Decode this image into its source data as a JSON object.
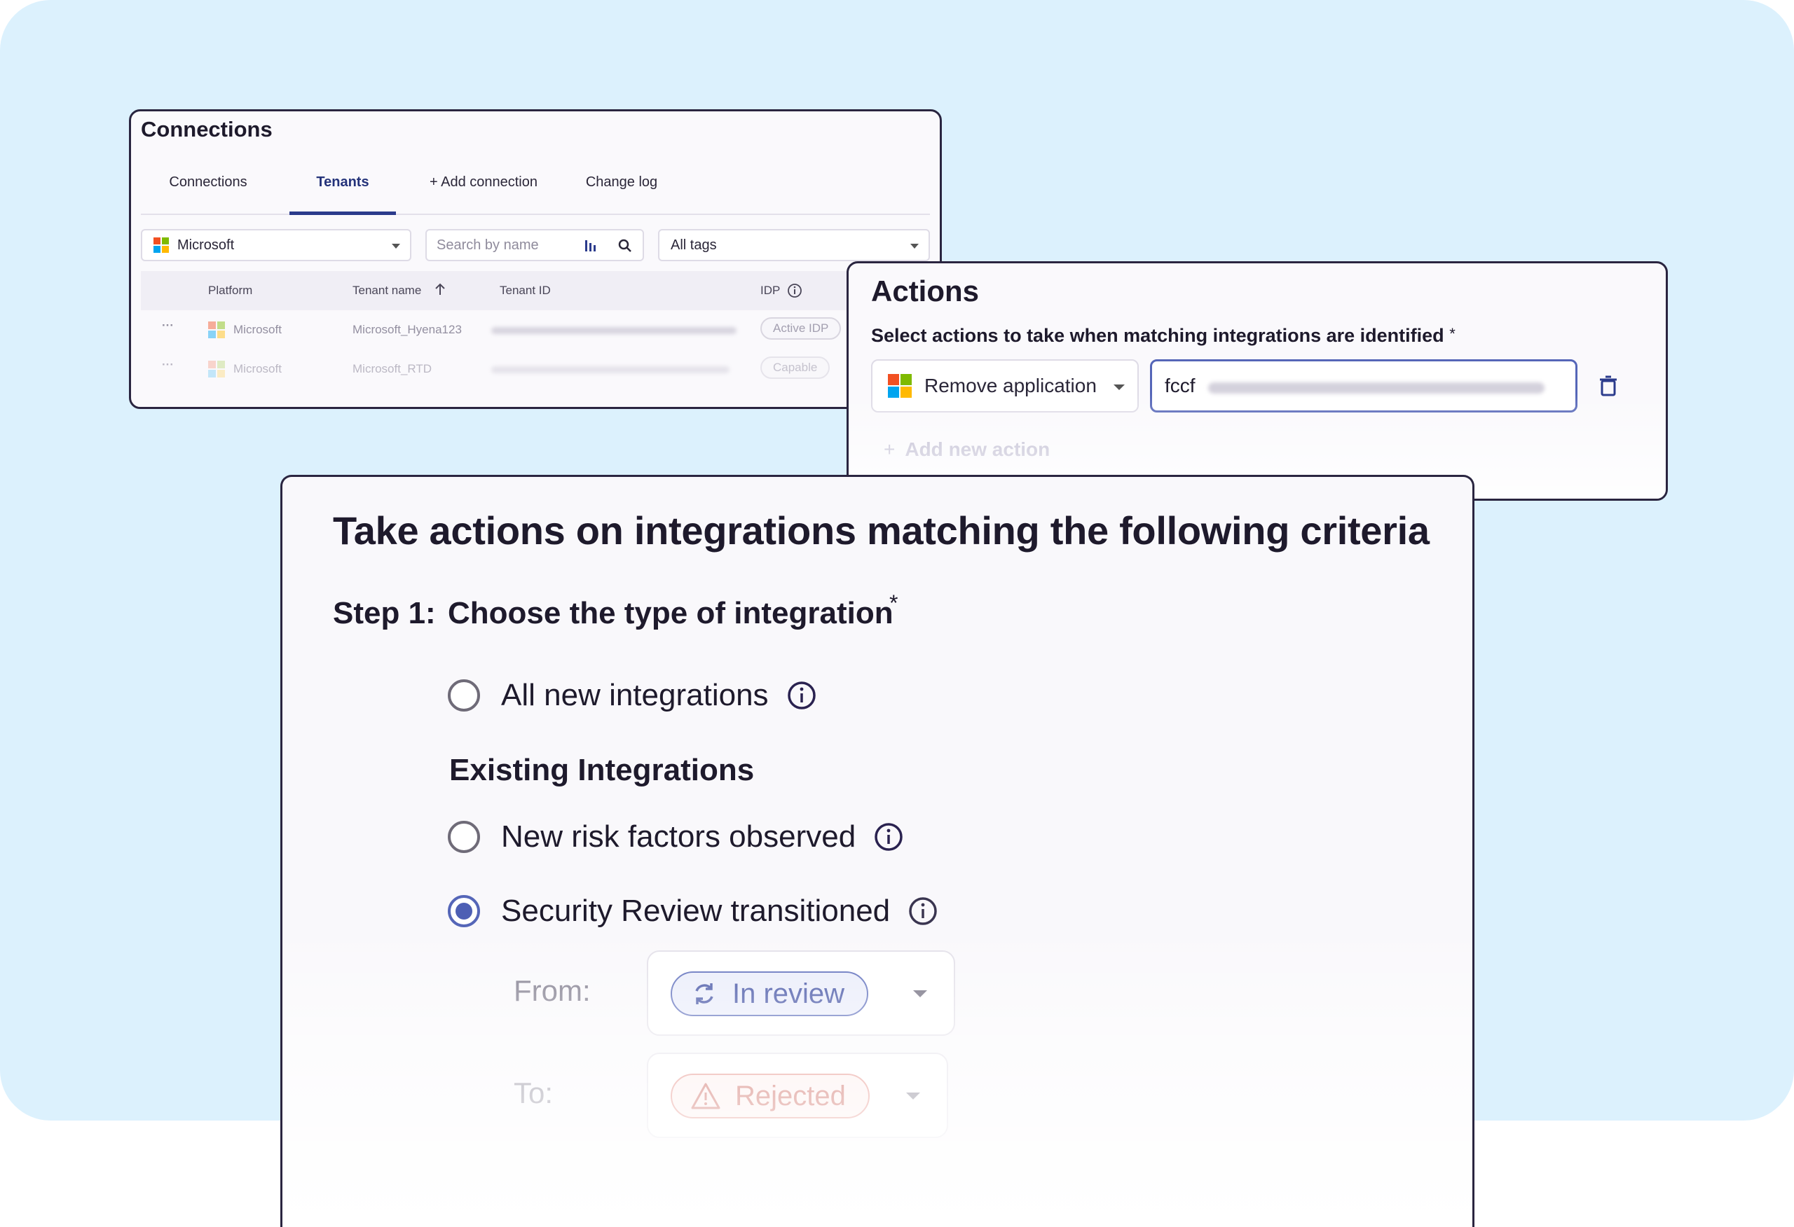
{
  "colors": {
    "background": "#dcf1fd",
    "accent": "#2b3b8c",
    "radio_selected": "#4d5fb4",
    "in_review": "#3a4aa0",
    "rejected": "#c0453a"
  },
  "connections": {
    "title": "Connections",
    "tabs": [
      {
        "label": "Connections",
        "active": false
      },
      {
        "label": "Tenants",
        "active": true
      },
      {
        "label": "+ Add connection",
        "active": false
      },
      {
        "label": "Change log",
        "active": false
      }
    ],
    "platform_filter": {
      "value": "Microsoft",
      "icon": "microsoft-logo"
    },
    "search": {
      "placeholder": "Search by name",
      "icons": [
        "column-settings-icon",
        "search-icon"
      ]
    },
    "tags_filter": {
      "value": "All tags"
    },
    "table": {
      "columns": [
        "Platform",
        "Tenant name",
        "Tenant ID",
        "IDP"
      ],
      "sort_column": "Tenant name",
      "sort_direction": "ascending",
      "rows": [
        {
          "menu": "···",
          "platform": "Microsoft",
          "tenant_name": "Microsoft_Hyena123",
          "idp": "Active IDP"
        },
        {
          "menu": "···",
          "platform": "Microsoft",
          "tenant_name": "Microsoft_RTD",
          "idp": "Capable"
        }
      ]
    }
  },
  "actions": {
    "title": "Actions",
    "subtitle": "Select actions to take when matching integrations are identified",
    "required_mark": "*",
    "action_select": {
      "value": "Remove application",
      "icon": "microsoft-logo"
    },
    "action_value": "fccf",
    "delete_icon": "trash-icon",
    "add_new_action": "Add new action"
  },
  "criteria": {
    "title": "Take actions on integrations matching the following criteria",
    "step_label": "Step 1:",
    "step_text": "Choose the type of integration",
    "required_mark": "*",
    "options": [
      {
        "label": "All new integrations",
        "checked": false
      },
      {
        "label": "New risk factors observed",
        "checked": false
      },
      {
        "label": "Security Review transitioned",
        "checked": true
      }
    ],
    "existing_heading": "Existing Integrations",
    "from_label": "From:",
    "from_status": {
      "label": "In review",
      "icon": "sync-icon"
    },
    "to_label": "To:",
    "to_status": {
      "label": "Rejected",
      "icon": "warning-icon"
    }
  }
}
